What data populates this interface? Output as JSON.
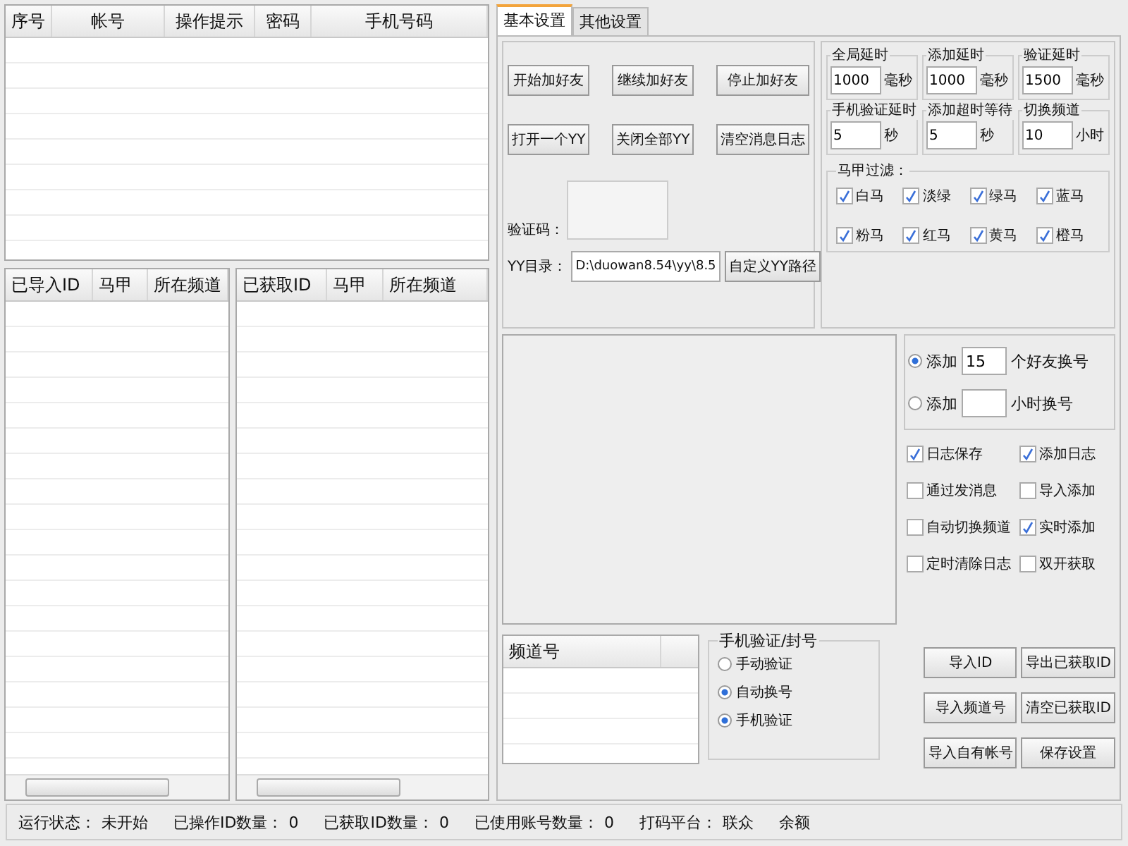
{
  "accounts_table": {
    "columns": [
      "序号",
      "帐号",
      "操作提示",
      "密码",
      "手机号码"
    ]
  },
  "imported_table": {
    "columns": [
      "已导入ID",
      "马甲",
      "所在频道"
    ]
  },
  "fetched_table": {
    "columns": [
      "已获取ID",
      "马甲",
      "所在频道"
    ]
  },
  "tabs": [
    {
      "label": "基本设置",
      "selected": true
    },
    {
      "label": "其他设置",
      "selected": false
    }
  ],
  "action_buttons": [
    "开始加好友",
    "继续加好友",
    "停止加好友",
    "打开一个YY",
    "关闭全部YY",
    "清空消息日志"
  ],
  "captcha": {
    "label": "验证码："
  },
  "yy_dir": {
    "label": "YY目录：",
    "value": "D:\\duowan8.54\\yy\\8.5",
    "button": "自定义YY路径"
  },
  "delays": [
    {
      "label": "全局延时",
      "value": "1000",
      "unit": "毫秒"
    },
    {
      "label": "添加延时",
      "value": "1000",
      "unit": "毫秒"
    },
    {
      "label": "验证延时",
      "value": "1500",
      "unit": "毫秒"
    },
    {
      "label": "手机验证延时",
      "value": "5",
      "unit": "秒"
    },
    {
      "label": "添加超时等待",
      "value": "5",
      "unit": "秒"
    },
    {
      "label": "切换频道",
      "value": "10",
      "unit": "小时"
    }
  ],
  "vest_filter": {
    "title": "马甲过滤：",
    "items": [
      {
        "label": "白马",
        "checked": true
      },
      {
        "label": "淡绿",
        "checked": true
      },
      {
        "label": "绿马",
        "checked": true
      },
      {
        "label": "蓝马",
        "checked": true
      },
      {
        "label": "粉马",
        "checked": true
      },
      {
        "label": "红马",
        "checked": true
      },
      {
        "label": "黄马",
        "checked": true
      },
      {
        "label": "橙马",
        "checked": true
      }
    ]
  },
  "switch_options": [
    {
      "prefix": "添加",
      "value": "15",
      "suffix": "个好友换号",
      "selected": true
    },
    {
      "prefix": "添加",
      "suffix": "小时换号",
      "selected": false
    }
  ],
  "options": [
    {
      "label": "日志保存",
      "checked": true
    },
    {
      "label": "添加日志",
      "checked": true
    },
    {
      "label": "通过发消息",
      "checked": false
    },
    {
      "label": "导入添加",
      "checked": false
    },
    {
      "label": "自动切换频道",
      "checked": false
    },
    {
      "label": "实时添加",
      "checked": true
    },
    {
      "label": "定时清除日志",
      "checked": false
    },
    {
      "label": "双开获取",
      "checked": false
    }
  ],
  "channel_table": {
    "columns": [
      "频道号"
    ]
  },
  "phone_verify": {
    "title": "手机验证/封号",
    "items": [
      {
        "label": "手动验证",
        "selected": false
      },
      {
        "label": "自动换号",
        "selected": true
      },
      {
        "label": "手机验证",
        "selected": true
      }
    ]
  },
  "side_buttons": [
    "导入ID",
    "导出已获取ID",
    "导入频道号",
    "清空已获取ID",
    "导入自有帐号",
    "保存设置"
  ],
  "status_bar": [
    {
      "label": "运行状态：",
      "value": "未开始"
    },
    {
      "label": "已操作ID数量：",
      "value": "0"
    },
    {
      "label": "已获取ID数量：",
      "value": "0"
    },
    {
      "label": "已使用账号数量：",
      "value": "0"
    },
    {
      "label": "打码平台：",
      "value": "联众"
    },
    {
      "label": "余额"
    }
  ]
}
